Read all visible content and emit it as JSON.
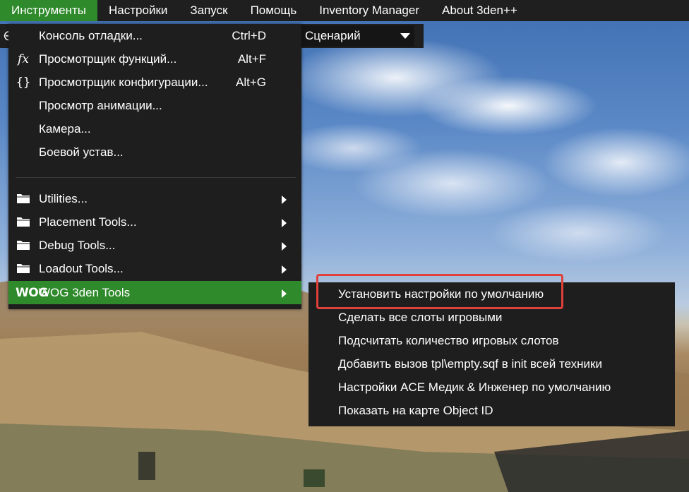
{
  "menubar": {
    "items": [
      {
        "label": "Инструменты",
        "active": true
      },
      {
        "label": "Настройки"
      },
      {
        "label": "Запуск"
      },
      {
        "label": "Помощь"
      },
      {
        "label": "Inventory Manager"
      },
      {
        "label": "About 3den++"
      }
    ]
  },
  "toolbar": {
    "scenario_label": "Сценарий"
  },
  "tools_menu": {
    "items": [
      {
        "label": "Консоль отладки...",
        "shortcut": "Ctrl+D",
        "icon": "none"
      },
      {
        "label": "Просмотрщик функций...",
        "shortcut": "Alt+F",
        "icon": "fx-icon",
        "icon_glyph": "fx"
      },
      {
        "label": "Просмотрщик конфигурации...",
        "shortcut": "Alt+G",
        "icon": "braces-icon",
        "icon_glyph": "{}"
      },
      {
        "label": "Просмотр анимации...",
        "shortcut": "",
        "icon": "none"
      },
      {
        "label": "Камера...",
        "shortcut": "",
        "icon": "none"
      },
      {
        "label": "Боевой устав...",
        "shortcut": "",
        "icon": "none"
      },
      {
        "label": "Utilities...",
        "icon": "folder-icon",
        "has_submenu": true
      },
      {
        "label": "Placement Tools...",
        "icon": "folder-icon",
        "has_submenu": true
      },
      {
        "label": "Debug Tools...",
        "icon": "folder-icon",
        "has_submenu": true
      },
      {
        "label": "Loadout Tools...",
        "icon": "folder-icon",
        "has_submenu": true
      },
      {
        "label": "WOG 3den Tools",
        "icon": "wog-logo-icon",
        "icon_glyph": "WOG",
        "has_submenu": true,
        "highlighted": true
      }
    ]
  },
  "wog_submenu": {
    "items": [
      {
        "label": "Установить настройки по умолчанию",
        "callout": true
      },
      {
        "label": "Сделать все слоты игровыми"
      },
      {
        "label": "Подсчитать количество игровых слотов"
      },
      {
        "label": "Добавить вызов tpl\\empty.sqf в init всей техники"
      },
      {
        "label": "Настройки ACE Медик & Инженер по умолчанию"
      },
      {
        "label": "Показать на карте Object ID"
      }
    ]
  },
  "colors": {
    "accent_green": "#2f8a2c",
    "menu_bg": "#1e1e1e",
    "callout_red": "#e0403a",
    "text": "#ffffff"
  }
}
